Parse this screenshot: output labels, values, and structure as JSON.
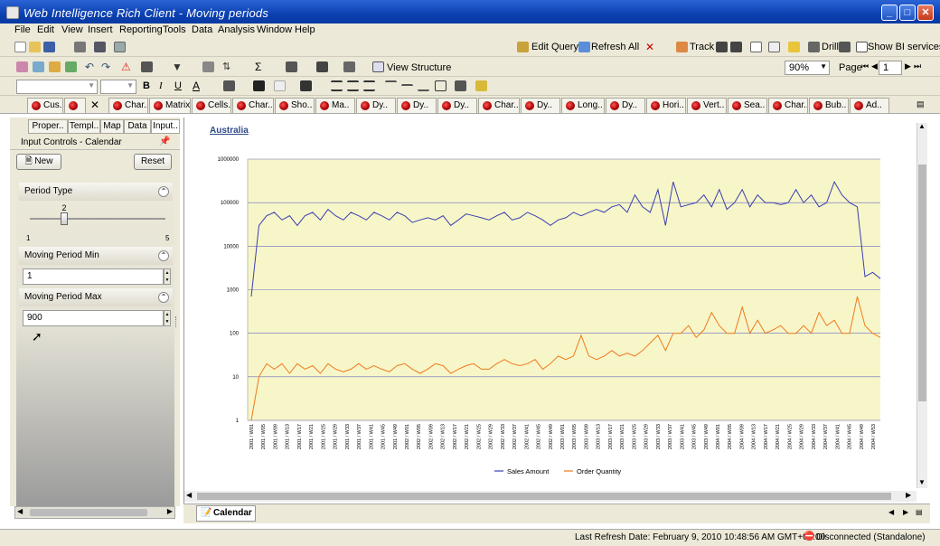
{
  "window": {
    "title": "Web Intelligence Rich Client - Moving periods"
  },
  "menu": [
    "File",
    "Edit",
    "View",
    "Insert",
    "Reporting",
    "Tools",
    "Data",
    "Analysis",
    "Window",
    "Help"
  ],
  "toolbar1": {
    "edit_query": "Edit Query",
    "refresh_all": "Refresh All",
    "track": "Track",
    "drill": "Drill",
    "show_bi": "Show BI services"
  },
  "toolbar2": {
    "view_structure": "View Structure",
    "zoom": "90%",
    "page_label": "Page",
    "page_value": "1"
  },
  "report_tabs": [
    "Cus..",
    "",
    "Char..",
    "Matrix",
    "Cells..",
    "Char..",
    "Sho..",
    "Ma..",
    "Dy..",
    "Dy..",
    "Dy..",
    "Char..",
    "Dy..",
    "Long..",
    "Dy..",
    "Hori..",
    "Vert..",
    "Sea..",
    "Char..",
    "Bub..",
    "Ad.."
  ],
  "left_tabs": [
    "Proper..",
    "Templ..",
    "Map",
    "Data",
    "Input.."
  ],
  "panel": {
    "title": "Input Controls - Calendar",
    "new_label": "New",
    "reset_label": "Reset",
    "controls": [
      {
        "label": "Period Type",
        "slider_value": "2",
        "slider_min": "1",
        "slider_max": "5",
        "slider_fraction": 0.25
      },
      {
        "label": "Moving Period Min",
        "value": "1"
      },
      {
        "label": "Moving Period Max",
        "value": "900"
      }
    ]
  },
  "report": {
    "heading": "Australia",
    "sheet_tab": "Calendar"
  },
  "chart_data": {
    "type": "line",
    "title": "",
    "xlabel": "",
    "ylabel": "",
    "yscale": "log",
    "ylim": [
      1,
      1000000
    ],
    "yticks": [
      "1",
      "10",
      "100",
      "1000",
      "10000",
      "100000",
      "1000000"
    ],
    "grid": true,
    "legend": "bottom",
    "background": "#f7f6c9",
    "x_tick_labels": [
      "2001 / W01",
      "2001 / W05",
      "2001 / W09",
      "2001 / W13",
      "2001 / W17",
      "2001 / W21",
      "2001 / W25",
      "2001 / W29",
      "2001 / W33",
      "2001 / W37",
      "2001 / W41",
      "2001 / W45",
      "2001 / W49",
      "2002 / W01",
      "2002 / W05",
      "2002 / W09",
      "2002 / W13",
      "2002 / W17",
      "2002 / W21",
      "2002 / W25",
      "2002 / W29",
      "2002 / W33",
      "2002 / W37",
      "2002 / W41",
      "2002 / W45",
      "2002 / W49",
      "2003 / W01",
      "2003 / W05",
      "2003 / W09",
      "2003 / W13",
      "2003 / W17",
      "2003 / W21",
      "2003 / W25",
      "2003 / W29",
      "2003 / W33",
      "2003 / W37",
      "2003 / W41",
      "2003 / W45",
      "2003 / W49",
      "2004 / W01",
      "2004 / W05",
      "2004 / W09",
      "2004 / W13",
      "2004 / W17",
      "2004 / W21",
      "2004 / W25",
      "2004 / W29",
      "2004 / W33",
      "2004 / W37",
      "2004 / W41",
      "2004 / W45",
      "2004 / W49",
      "2004 / W53"
    ],
    "series": [
      {
        "name": "Sales Amount",
        "color": "#3a3fb0",
        "values": [
          700,
          30000,
          50000,
          60000,
          40000,
          50000,
          30000,
          50000,
          60000,
          40000,
          70000,
          50000,
          40000,
          60000,
          50000,
          40000,
          60000,
          50000,
          40000,
          60000,
          50000,
          35000,
          40000,
          45000,
          40000,
          50000,
          30000,
          40000,
          55000,
          50000,
          45000,
          40000,
          50000,
          60000,
          40000,
          45000,
          60000,
          50000,
          40000,
          30000,
          40000,
          45000,
          60000,
          50000,
          60000,
          70000,
          60000,
          80000,
          90000,
          60000,
          150000,
          80000,
          60000,
          200000,
          30000,
          300000,
          80000,
          90000,
          100000,
          150000,
          80000,
          200000,
          70000,
          100000,
          200000,
          80000,
          150000,
          100000,
          100000,
          90000,
          100000,
          200000,
          100000,
          150000,
          80000,
          100000,
          300000,
          150000,
          100000,
          80000,
          2000,
          2500,
          1800
        ]
      },
      {
        "name": "Order Quantity",
        "color": "#f07a1d",
        "values": [
          1,
          10,
          20,
          15,
          20,
          12,
          20,
          15,
          18,
          12,
          20,
          15,
          13,
          15,
          20,
          15,
          18,
          15,
          13,
          18,
          20,
          15,
          12,
          15,
          20,
          18,
          12,
          15,
          18,
          20,
          15,
          15,
          20,
          25,
          20,
          18,
          20,
          25,
          15,
          20,
          30,
          25,
          30,
          90,
          30,
          25,
          30,
          40,
          30,
          35,
          30,
          40,
          60,
          90,
          40,
          100,
          100,
          150,
          80,
          120,
          300,
          150,
          100,
          100,
          400,
          100,
          200,
          100,
          120,
          150,
          100,
          100,
          150,
          100,
          300,
          150,
          200,
          100,
          100,
          700,
          150,
          100,
          80
        ]
      }
    ]
  },
  "status": {
    "last_refresh": "Last Refresh Date: February 9, 2010 10:48:56 AM GMT+01:00",
    "connection": "Disconnected (Standalone)"
  }
}
